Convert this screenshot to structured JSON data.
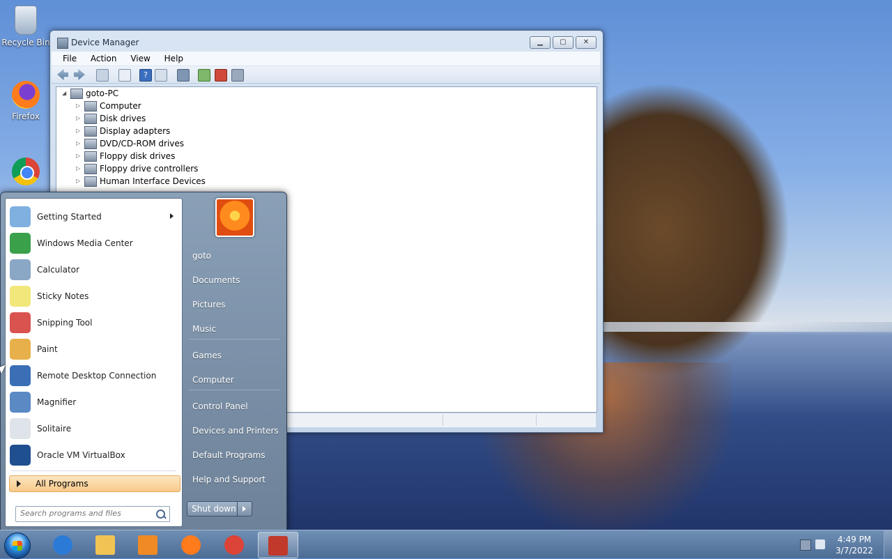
{
  "desktop": {
    "icons": [
      {
        "label": "Recycle Bin",
        "icon": "recycle-bin-icon"
      },
      {
        "label": "Firefox",
        "icon": "firefox-icon"
      },
      {
        "label": "",
        "icon": "chrome-icon"
      }
    ]
  },
  "window": {
    "title": "Device Manager",
    "menu": [
      "File",
      "Action",
      "View",
      "Help"
    ],
    "tree": {
      "root": "goto-PC",
      "nodes": [
        "Computer",
        "Disk drives",
        "Display adapters",
        "DVD/CD-ROM drives",
        "Floppy disk drives",
        "Floppy drive controllers",
        "Human Interface Devices"
      ]
    }
  },
  "start_menu": {
    "programs": [
      {
        "label": "Getting Started",
        "icon": "getting-started-icon",
        "has_submenu": true,
        "color": "#7fb0e0"
      },
      {
        "label": "Windows Media Center",
        "icon": "media-center-icon",
        "has_submenu": false,
        "color": "#3aa04a"
      },
      {
        "label": "Calculator",
        "icon": "calculator-icon",
        "has_submenu": false,
        "color": "#8aa7c6"
      },
      {
        "label": "Sticky Notes",
        "icon": "sticky-notes-icon",
        "has_submenu": false,
        "color": "#f2e77a"
      },
      {
        "label": "Snipping Tool",
        "icon": "scissors-icon",
        "has_submenu": false,
        "color": "#d9534f"
      },
      {
        "label": "Paint",
        "icon": "paint-palette-icon",
        "has_submenu": false,
        "color": "#e8b04a"
      },
      {
        "label": "Remote Desktop Connection",
        "icon": "remote-desktop-icon",
        "has_submenu": false,
        "color": "#3a6fb5"
      },
      {
        "label": "Magnifier",
        "icon": "magnifier-icon",
        "has_submenu": false,
        "color": "#5a89c4"
      },
      {
        "label": "Solitaire",
        "icon": "solitaire-icon",
        "has_submenu": false,
        "color": "#dfe4ea"
      },
      {
        "label": "Oracle VM VirtualBox",
        "icon": "virtualbox-icon",
        "has_submenu": false,
        "color": "#1f4f8f"
      }
    ],
    "all_programs": "All Programs",
    "search_placeholder": "Search programs and files",
    "user": "goto",
    "right_items": [
      "goto",
      "Documents",
      "Pictures",
      "Music",
      "Games",
      "Computer",
      "Control Panel",
      "Devices and Printers",
      "Default Programs",
      "Help and Support"
    ],
    "shutdown": "Shut down"
  },
  "taskbar": {
    "apps": [
      {
        "icon": "internet-explorer-icon",
        "color": "#2b7bd6"
      },
      {
        "icon": "file-explorer-icon",
        "color": "#f0c454"
      },
      {
        "icon": "media-player-icon",
        "color": "#f08a24"
      },
      {
        "icon": "firefox-icon",
        "color": "#ff7b1c"
      },
      {
        "icon": "chrome-icon",
        "color": "#db4437"
      },
      {
        "icon": "device-manager-icon",
        "color": "#c0392b"
      }
    ],
    "time": "4:49 PM",
    "date": "3/7/2022"
  }
}
